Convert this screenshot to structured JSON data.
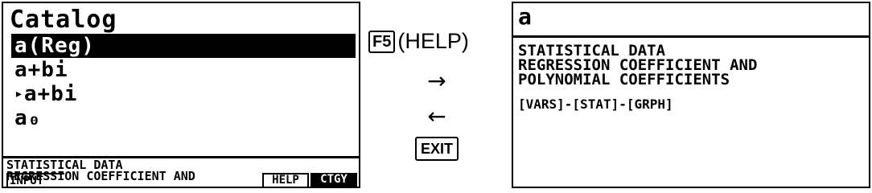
{
  "left_screen": {
    "title": "Catalog",
    "items": [
      {
        "label": "a(Reg)",
        "selected": true
      },
      {
        "label": "a+bi",
        "selected": false
      },
      {
        "marker": "▸",
        "label": "a+bi",
        "selected": false
      },
      {
        "label": "a₀",
        "selected": false
      }
    ],
    "help_preview": {
      "line1": "STATISTICAL DATA",
      "line2": "REGRESSION COEFFICIENT AND",
      "more": ">>"
    },
    "function_keys": {
      "f1": "INPUT",
      "f5": "HELP",
      "f6": "CTGY"
    }
  },
  "middle": {
    "key_f5": "F5",
    "key_f5_label": "(HELP)",
    "arrow_forward": "→",
    "arrow_back": "←",
    "key_exit": "EXIT"
  },
  "right_screen": {
    "title": "a",
    "description": {
      "line1": "STATISTICAL DATA",
      "line2": "REGRESSION COEFFICIENT AND",
      "line3": "POLYNOMIAL COEFFICIENTS"
    },
    "key_path": "[VARS]-[STAT]-[GRPH]"
  }
}
